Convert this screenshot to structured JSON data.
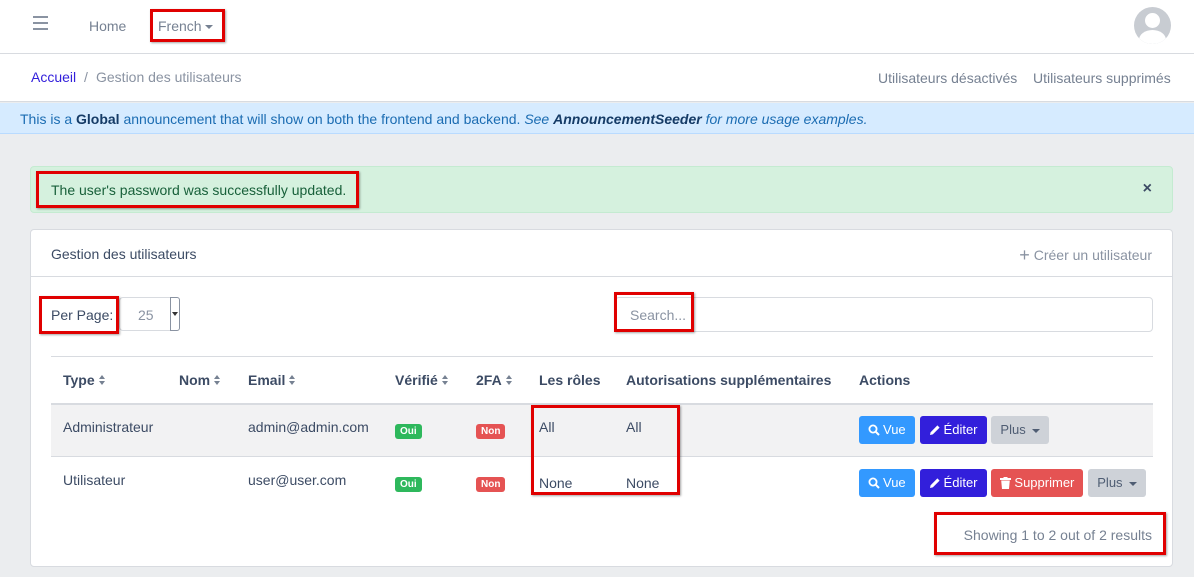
{
  "header": {
    "home_label": "Home",
    "language_label": "French"
  },
  "breadcrumb": {
    "home": "Accueil",
    "separator": "/",
    "current": "Gestion des utilisateurs"
  },
  "subheader_links": {
    "deactivated": "Utilisateurs désactivés",
    "deleted": "Utilisateurs supprimés"
  },
  "announcement": {
    "prefix": "This is a ",
    "bold": "Global",
    "middle": " announcement that will show on both the frontend and backend. ",
    "italic_see": "See ",
    "italic_bold": "AnnouncementSeeder",
    "italic_end": " for more usage examples."
  },
  "alert": {
    "message": "The user's password was successfully updated.",
    "close": "×"
  },
  "card": {
    "title": "Gestion des utilisateurs",
    "create_label": "Créer un utilisateur",
    "per_page_label": "Per Page:",
    "per_page_value": "25",
    "search_placeholder": "Search..."
  },
  "table": {
    "columns": [
      "Type",
      "Nom",
      "Email",
      "Vérifié",
      "2FA",
      "Les rôles",
      "Autorisations supplémentaires",
      "Actions"
    ],
    "rows": [
      {
        "type": "Administrateur",
        "name": "",
        "email": "admin@admin.com",
        "verified": "Oui",
        "twofa": "Non",
        "roles": "All",
        "permissions": "All",
        "actions": {
          "view": "Vue",
          "edit": "Éditer",
          "more": "Plus"
        }
      },
      {
        "type": "Utilisateur",
        "name": "",
        "email": "user@user.com",
        "verified": "Oui",
        "twofa": "Non",
        "roles": "None",
        "permissions": "None",
        "actions": {
          "view": "Vue",
          "edit": "Éditer",
          "delete": "Supprimer",
          "more": "Plus"
        }
      }
    ]
  },
  "summary": "Showing 1 to 2 out of 2 results",
  "colors": {
    "primary": "#321fdb",
    "info": "#3399ff",
    "danger": "#e55353",
    "success": "#2eb85c",
    "highlight": "#e00000"
  }
}
